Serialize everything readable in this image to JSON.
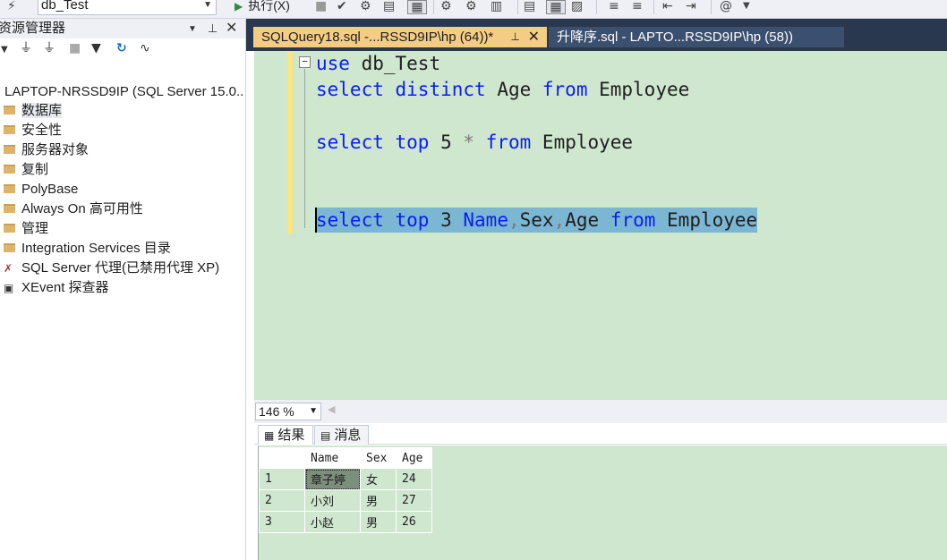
{
  "toolbar": {
    "database": "db_Test",
    "execute_label": "执行(X)"
  },
  "explorer": {
    "title": "资源管理器",
    "server": "LAPTOP-NRSSD9IP (SQL Server 15.0..",
    "items": [
      {
        "label": "数据库",
        "icon": "folder-icon"
      },
      {
        "label": "安全性",
        "icon": "folder-icon"
      },
      {
        "label": "服务器对象",
        "icon": "folder-icon"
      },
      {
        "label": "复制",
        "icon": "folder-icon"
      },
      {
        "label": "PolyBase",
        "icon": "folder-icon"
      },
      {
        "label": "Always On 高可用性",
        "icon": "folder-icon"
      },
      {
        "label": "管理",
        "icon": "folder-icon"
      },
      {
        "label": "Integration Services 目录",
        "icon": "folder-icon"
      },
      {
        "label": "SQL Server 代理(已禁用代理 XP)",
        "icon": "agent-disabled-icon"
      },
      {
        "label": "XEvent 探查器",
        "icon": "xevent-icon"
      }
    ]
  },
  "tabs": [
    {
      "label": "SQLQuery18.sql -...RSSD9IP\\hp (64))*",
      "active": true
    },
    {
      "label": "升降序.sql - LAPTO...RSSD9IP\\hp (58))",
      "active": false
    }
  ],
  "editor": {
    "lines": [
      {
        "kw1": "use",
        "rest": " db_Test"
      },
      {
        "kw1": "select",
        "kw2": "distinct",
        "t1": " Age ",
        "kw3": "from",
        "t2": " Employee"
      },
      {
        "kw1": "select",
        "kw2": "top",
        "t1": " 5 ",
        "op": "*",
        "kw3": "from",
        "t2": " Employee"
      },
      {
        "kw1": "select",
        "kw2": "top",
        "t1": " 3 ",
        "name": "Name",
        "sex": "Sex",
        "age": "Age",
        "kw3": "from",
        "t2": " Employee"
      }
    ],
    "zoom": "146 %"
  },
  "results": {
    "tab_results": "结果",
    "tab_messages": "消息",
    "columns": [
      "Name",
      "Sex",
      "Age"
    ],
    "rows": [
      {
        "n": "1",
        "name": "章子婷",
        "sex": "女",
        "age": "24"
      },
      {
        "n": "2",
        "name": "小刘",
        "sex": "男",
        "age": "27"
      },
      {
        "n": "3",
        "name": "小赵",
        "sex": "男",
        "age": "26"
      }
    ]
  }
}
